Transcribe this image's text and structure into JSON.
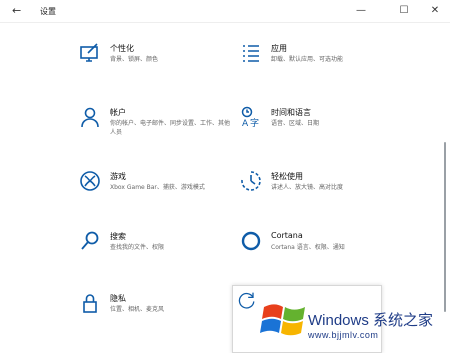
{
  "titlebar": {
    "back_glyph": "←",
    "title": "设置",
    "minimize_glyph": "—",
    "maximize_glyph": "☐",
    "close_glyph": "✕"
  },
  "settings": [
    {
      "icon": "personalization-icon",
      "label": "个性化",
      "desc": "背景、锁屏、颜色"
    },
    {
      "icon": "apps-icon",
      "label": "应用",
      "desc": "卸载、默认应用、可选功能"
    },
    {
      "icon": "accounts-icon",
      "label": "帐户",
      "desc": "你的帐户、电子邮件、同步设置、工作、其他人员"
    },
    {
      "icon": "time-language-icon",
      "label": "时间和语言",
      "desc": "语音、区域、日期"
    },
    {
      "icon": "gaming-icon",
      "label": "游戏",
      "desc": "Xbox Game Bar、捕获、游戏模式"
    },
    {
      "icon": "ease-of-access-icon",
      "label": "轻松使用",
      "desc": "讲述人、放大镜、高对比度"
    },
    {
      "icon": "search-icon",
      "label": "搜索",
      "desc": "查找我的文件、权限"
    },
    {
      "icon": "cortana-icon",
      "label": "Cortana",
      "desc": "Cortana 语言、权限、通知"
    },
    {
      "icon": "privacy-icon",
      "label": "隐私",
      "desc": "位置、相机、麦克风"
    }
  ],
  "watermark": {
    "title": "Windows 系统之家",
    "url": "www.bjjmlv.com",
    "colors": {
      "red": "#e8401c",
      "green": "#64b22f",
      "blue": "#1a73d6",
      "yellow": "#f7b500",
      "text": "#1f3c87"
    }
  }
}
